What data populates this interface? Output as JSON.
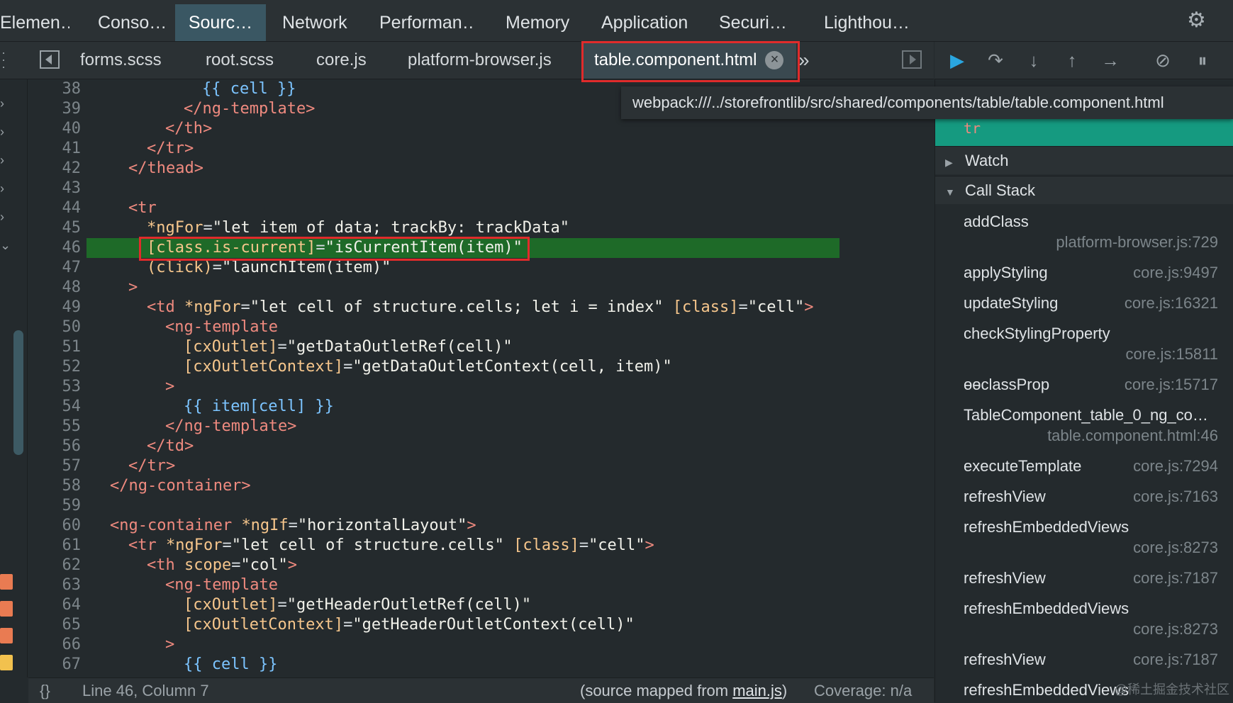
{
  "top_tabs": [
    "Elemen…",
    "Conso…",
    "Sourc…",
    "Network",
    "Performan…",
    "Memory",
    "Application",
    "Securi…",
    "Lighthou…"
  ],
  "file_tabs": [
    "forms.scss",
    "root.scss",
    "core.js",
    "platform-browser.js",
    "table.component.html"
  ],
  "tooltip": "webpack:///../storefrontlib/src/shared/components/table/table.component.html",
  "code_lines": [
    {
      "n": "38"
    },
    {
      "n": "39"
    },
    {
      "n": "40"
    },
    {
      "n": "41"
    },
    {
      "n": "42"
    },
    {
      "n": "43"
    },
    {
      "n": "44"
    },
    {
      "n": "45"
    },
    {
      "n": "46"
    },
    {
      "n": "47"
    },
    {
      "n": "48"
    },
    {
      "n": "49"
    },
    {
      "n": "50"
    },
    {
      "n": "51"
    },
    {
      "n": "52"
    },
    {
      "n": "53"
    },
    {
      "n": "54"
    },
    {
      "n": "55"
    },
    {
      "n": "56"
    },
    {
      "n": "57"
    },
    {
      "n": "58"
    },
    {
      "n": "59"
    },
    {
      "n": "60"
    },
    {
      "n": "61"
    },
    {
      "n": "62"
    },
    {
      "n": "63"
    },
    {
      "n": "64"
    },
    {
      "n": "65"
    },
    {
      "n": "66"
    },
    {
      "n": "67"
    }
  ],
  "code_text": {
    "l38": "{{ cell }}",
    "l39": "</ng-template>",
    "l40": "</th>",
    "l41": "</tr>",
    "l42": "</thead>",
    "l44": "<tr",
    "l45_attr": "*ngFor",
    "l45_val": "\"let item of data; trackBy: trackData\"",
    "l46_attr": "[class.is-current]",
    "l46_val": "\"isCurrentItem(item)\"",
    "l47_attr": "(click)",
    "l47_val": "\"launchItem(item)\"",
    "l48": ">",
    "l49_tag": "<td",
    "l49_attr1": "*ngFor",
    "l49_val1": "\"let cell of structure.cells; let i = index\"",
    "l49_attr2": "[class]",
    "l49_val2": "\"cell\"",
    "l49_end": ">",
    "l50": "<ng-template",
    "l51_attr": "[cxOutlet]",
    "l51_val": "\"getDataOutletRef(cell)\"",
    "l52_attr": "[cxOutletContext]",
    "l52_val": "\"getDataOutletContext(cell, item)\"",
    "l53": ">",
    "l54": "{{ item[cell] }}",
    "l55": "</ng-template>",
    "l56": "</td>",
    "l57": "</tr>",
    "l58": "</ng-container>",
    "l60_tag": "<ng-container",
    "l60_attr": "*ngIf",
    "l60_val": "\"horizontalLayout\"",
    "l60_end": ">",
    "l61_tag": "<tr",
    "l61_attr1": "*ngFor",
    "l61_val1": "\"let cell of structure.cells\"",
    "l61_attr2": "[class]",
    "l61_val2": "\"cell\"",
    "l61_end": ">",
    "l62_tag": "<th",
    "l62_attr": "scope",
    "l62_val": "\"col\"",
    "l62_end": ">",
    "l63": "<ng-template",
    "l64_attr": "[cxOutlet]",
    "l64_val": "\"getHeaderOutletRef(cell)\"",
    "l65_attr": "[cxOutletContext]",
    "l65_val": "\"getHeaderOutletContext(cell)\"",
    "l66": ">",
    "l67": "{{ cell }}"
  },
  "status": {
    "braces": "{}",
    "position": "Line 46, Column 7",
    "mapped_prefix": "(source mapped from ",
    "mapped_link": "main.js",
    "mapped_suffix": ")",
    "coverage": "Coverage: n/a"
  },
  "sidebar": {
    "paused_element": "tr",
    "watch_label": "Watch",
    "call_stack_label": "Call Stack",
    "frames": [
      {
        "name": "addClass",
        "loc": "platform-browser.js:729"
      },
      {
        "name": "applyStyling",
        "loc": "core.js:9497"
      },
      {
        "name": "updateStyling",
        "loc": "core.js:16321"
      },
      {
        "name": "checkStylingProperty",
        "loc": "core.js:15811"
      },
      {
        "name": "ɵɵclassProp",
        "loc": "core.js:15717"
      },
      {
        "name": "TableComponent_table_0_ng_co…",
        "loc": "table.component.html:46"
      },
      {
        "name": "executeTemplate",
        "loc": "core.js:7294"
      },
      {
        "name": "refreshView",
        "loc": "core.js:7163"
      },
      {
        "name": "refreshEmbeddedViews",
        "loc": "core.js:8273"
      },
      {
        "name": "refreshView",
        "loc": "core.js:7187"
      },
      {
        "name": "refreshEmbeddedViews",
        "loc": "core.js:8273"
      },
      {
        "name": "refreshView",
        "loc": "core.js:7187"
      },
      {
        "name": "refreshEmbeddedViews",
        "loc": ""
      }
    ]
  },
  "watermark": "@稀土掘金技术社区",
  "colors": {
    "highlight": "#1e6a28",
    "accent": "#159a80",
    "red_box": "#e02b2b"
  }
}
